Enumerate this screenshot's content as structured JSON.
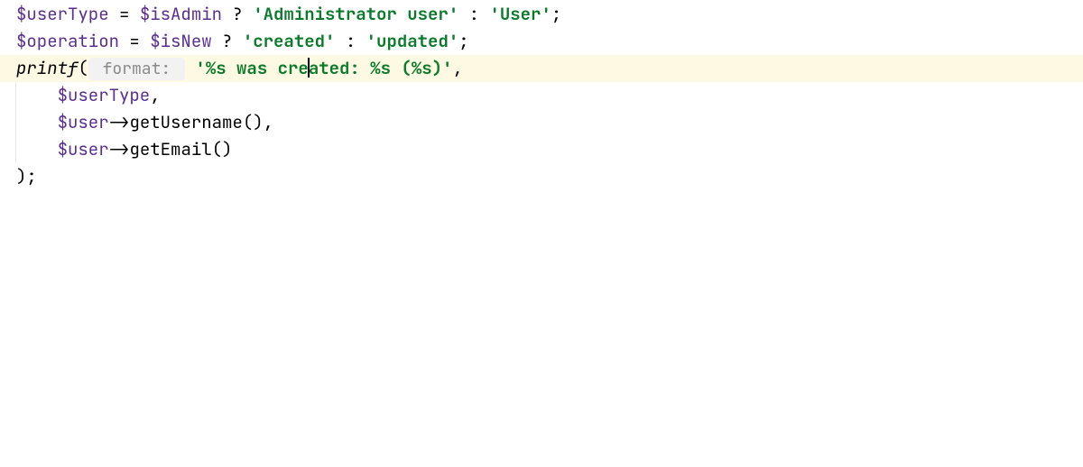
{
  "code": {
    "line1": {
      "var1": "$userType",
      "eq": " = ",
      "var2": "$isAdmin",
      "q": " ? ",
      "str1": "'Administrator user'",
      "colon": " : ",
      "str2": "'User'",
      "semi": ";"
    },
    "line2": {
      "var1": "$operation",
      "eq": " = ",
      "var2": "$isNew",
      "q": " ? ",
      "str1": "'created'",
      "colon": " : ",
      "str2": "'updated'",
      "semi": ";"
    },
    "line3": {
      "func": "printf",
      "open": "(",
      "hint": " format: ",
      "sp": " ",
      "str_a": "'%s was cre",
      "str_b": "ated: %s (%s)'",
      "comma": ","
    },
    "line4": {
      "indent": "    ",
      "var": "$userType",
      "comma": ","
    },
    "line5": {
      "indent": "    ",
      "var": "$user",
      "arrow": "->",
      "method": "getUsername",
      "call": "(),"
    },
    "line6": {
      "indent": "    ",
      "var": "$user",
      "arrow": "->",
      "method": "getEmail",
      "call": "()"
    },
    "line7": {
      "close": ");"
    }
  }
}
